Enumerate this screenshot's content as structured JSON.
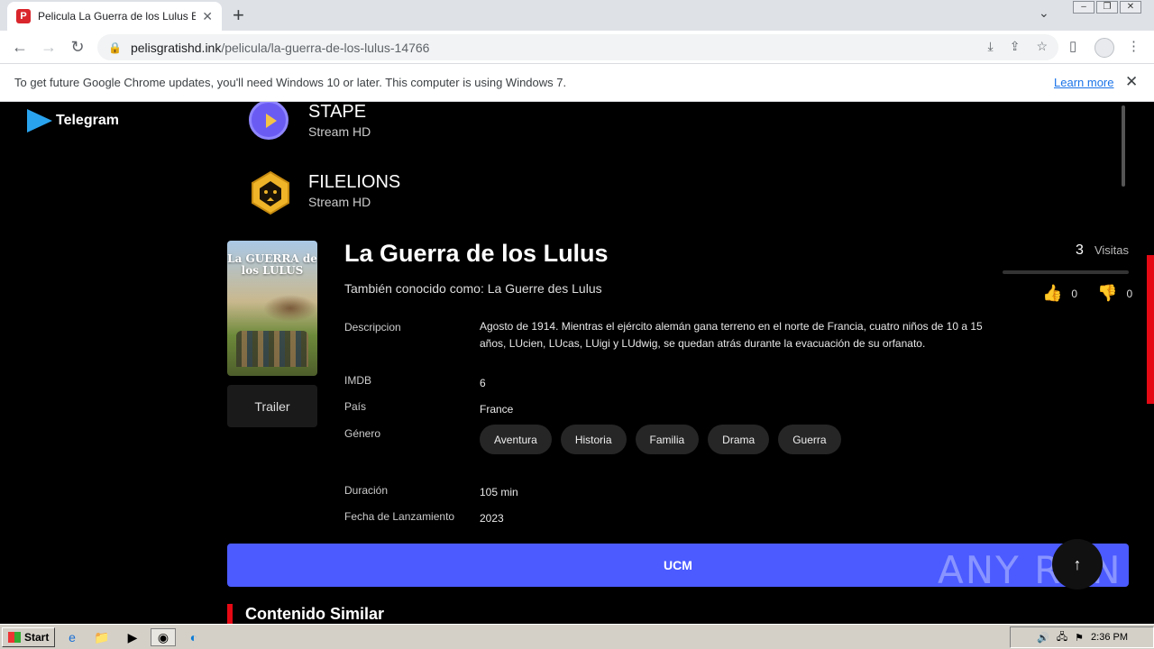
{
  "browser": {
    "tab_title": "Pelicula La Guerra de los Lulus Español",
    "tab_favicon": "P",
    "url_host": "pelisgratishd.ink",
    "url_path": "/pelicula/la-guerra-de-los-lulus-14766"
  },
  "infobar": {
    "message": "To get future Google Chrome updates, you'll need Windows 10 or later. This computer is using Windows 7.",
    "link": "Learn more"
  },
  "sidebar": {
    "telegram_label": "Telegram"
  },
  "servers": [
    {
      "name": "STAPE",
      "quality": "Stream HD"
    },
    {
      "name": "FILELIONS",
      "quality": "Stream HD"
    }
  ],
  "movie": {
    "poster_title": "La GUERRA de los LULUS",
    "trailer_label": "Trailer",
    "title": "La Guerra de los Lulus",
    "aka": "También conocido como: La Guerre des Lulus",
    "visits_count": "3",
    "visits_label": "Visitas",
    "likes": "0",
    "dislikes": "0",
    "fields": {
      "descripcion_label": "Descripcion",
      "descripcion": "Agosto de 1914. Mientras el ejército alemán gana terreno en el norte de Francia, cuatro niños de 10 a 15 años, LUcien, LUcas, LUigi y LUdwig, se quedan atrás durante la evacuación de su orfanato.",
      "imdb_label": "IMDB",
      "imdb": "6",
      "pais_label": "País",
      "pais": "France",
      "genero_label": "Género",
      "generos": [
        "Aventura",
        "Historia",
        "Familia",
        "Drama",
        "Guerra"
      ],
      "duracion_label": "Duración",
      "duracion": "105 min",
      "fecha_label": "Fecha de Lanzamiento",
      "fecha": "2023"
    }
  },
  "ucm_button": "UCM",
  "watermark": "ANY RUN",
  "similar_heading": "Contenido Similar",
  "taskbar": {
    "start_label": "Start",
    "clock": "2:36 PM"
  },
  "colors": {
    "accent_button": "#4b5bff",
    "section_marker": "#e50914",
    "telegram": "#2aa3ee"
  }
}
